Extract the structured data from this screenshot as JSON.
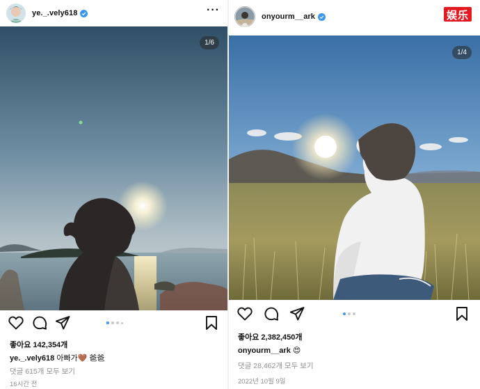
{
  "left_post": {
    "username": "ye._.vely618",
    "media_counter": "1/6",
    "likes": "좋아요 142,354개",
    "caption_user": "ye._.vely618",
    "caption_text": "아빠가🤎   爸爸",
    "comments_link": "댓글 615개 모두 보기",
    "time": "16시간 전",
    "carousel_dots": 4,
    "active_dot": 0,
    "icons": [
      "heart-icon",
      "comment-icon",
      "share-icon",
      "bookmark-icon",
      "more-icon",
      "verified-icon"
    ]
  },
  "right_post": {
    "username": "onyourm__ark",
    "media_counter": "1/4",
    "likes": "좋아요 2,382,450개",
    "caption_user": "onyourm__ark",
    "caption_text": "😍",
    "comments_link": "댓글 28,462개 모두 보기",
    "time": "2022년 10월 9일",
    "carousel_dots": 3,
    "active_dot": 0,
    "icons": [
      "heart-icon",
      "comment-icon",
      "share-icon",
      "bookmark-icon",
      "verified-icon"
    ]
  },
  "watermark": {
    "label": "娱乐",
    "color": "#e21b22"
  },
  "colors": {
    "verified": "#3897f0",
    "active_dot": "#3897f0",
    "muted_text": "#8e8e8e"
  }
}
